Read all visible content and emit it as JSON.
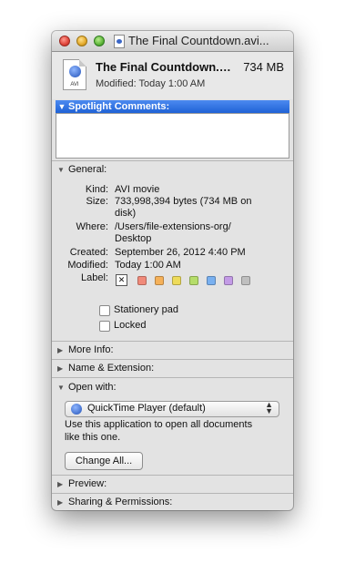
{
  "window": {
    "title": "The Final Countdown.avi..."
  },
  "header": {
    "filename": "The Final Countdown.avi",
    "size": "734 MB",
    "modified": "Modified: Today 1:00 AM",
    "icon_tag": "AVI"
  },
  "spotlight": {
    "label": "Spotlight Comments:",
    "text": ""
  },
  "general": {
    "label": "General:",
    "kind_label": "Kind:",
    "kind_value": "AVI movie",
    "size_label": "Size:",
    "size_value_line1": "733,998,394 bytes (734 MB on",
    "size_value_line2": "disk)",
    "where_label": "Where:",
    "where_value_line1": "/Users/file-extensions-org/",
    "where_value_line2": "Desktop",
    "created_label": "Created:",
    "created_value": "September 26, 2012 4:40 PM",
    "modified_label": "Modified:",
    "modified_value": "Today 1:00 AM",
    "label_label": "Label:",
    "label_colors": [
      "#f08a7a",
      "#f5b15a",
      "#eedb5a",
      "#b5dd6a",
      "#79b0f0",
      "#c39be6",
      "#bfbfbf"
    ],
    "stationery_label": "Stationery pad",
    "locked_label": "Locked"
  },
  "sections": {
    "more_info": "More Info:",
    "name_extension": "Name & Extension:",
    "open_with": "Open with:",
    "preview": "Preview:",
    "sharing": "Sharing & Permissions:"
  },
  "open_with": {
    "app": "QuickTime Player (default)",
    "help_line1": "Use this application to open all documents",
    "help_line2": "like this one.",
    "change_all": "Change All..."
  }
}
